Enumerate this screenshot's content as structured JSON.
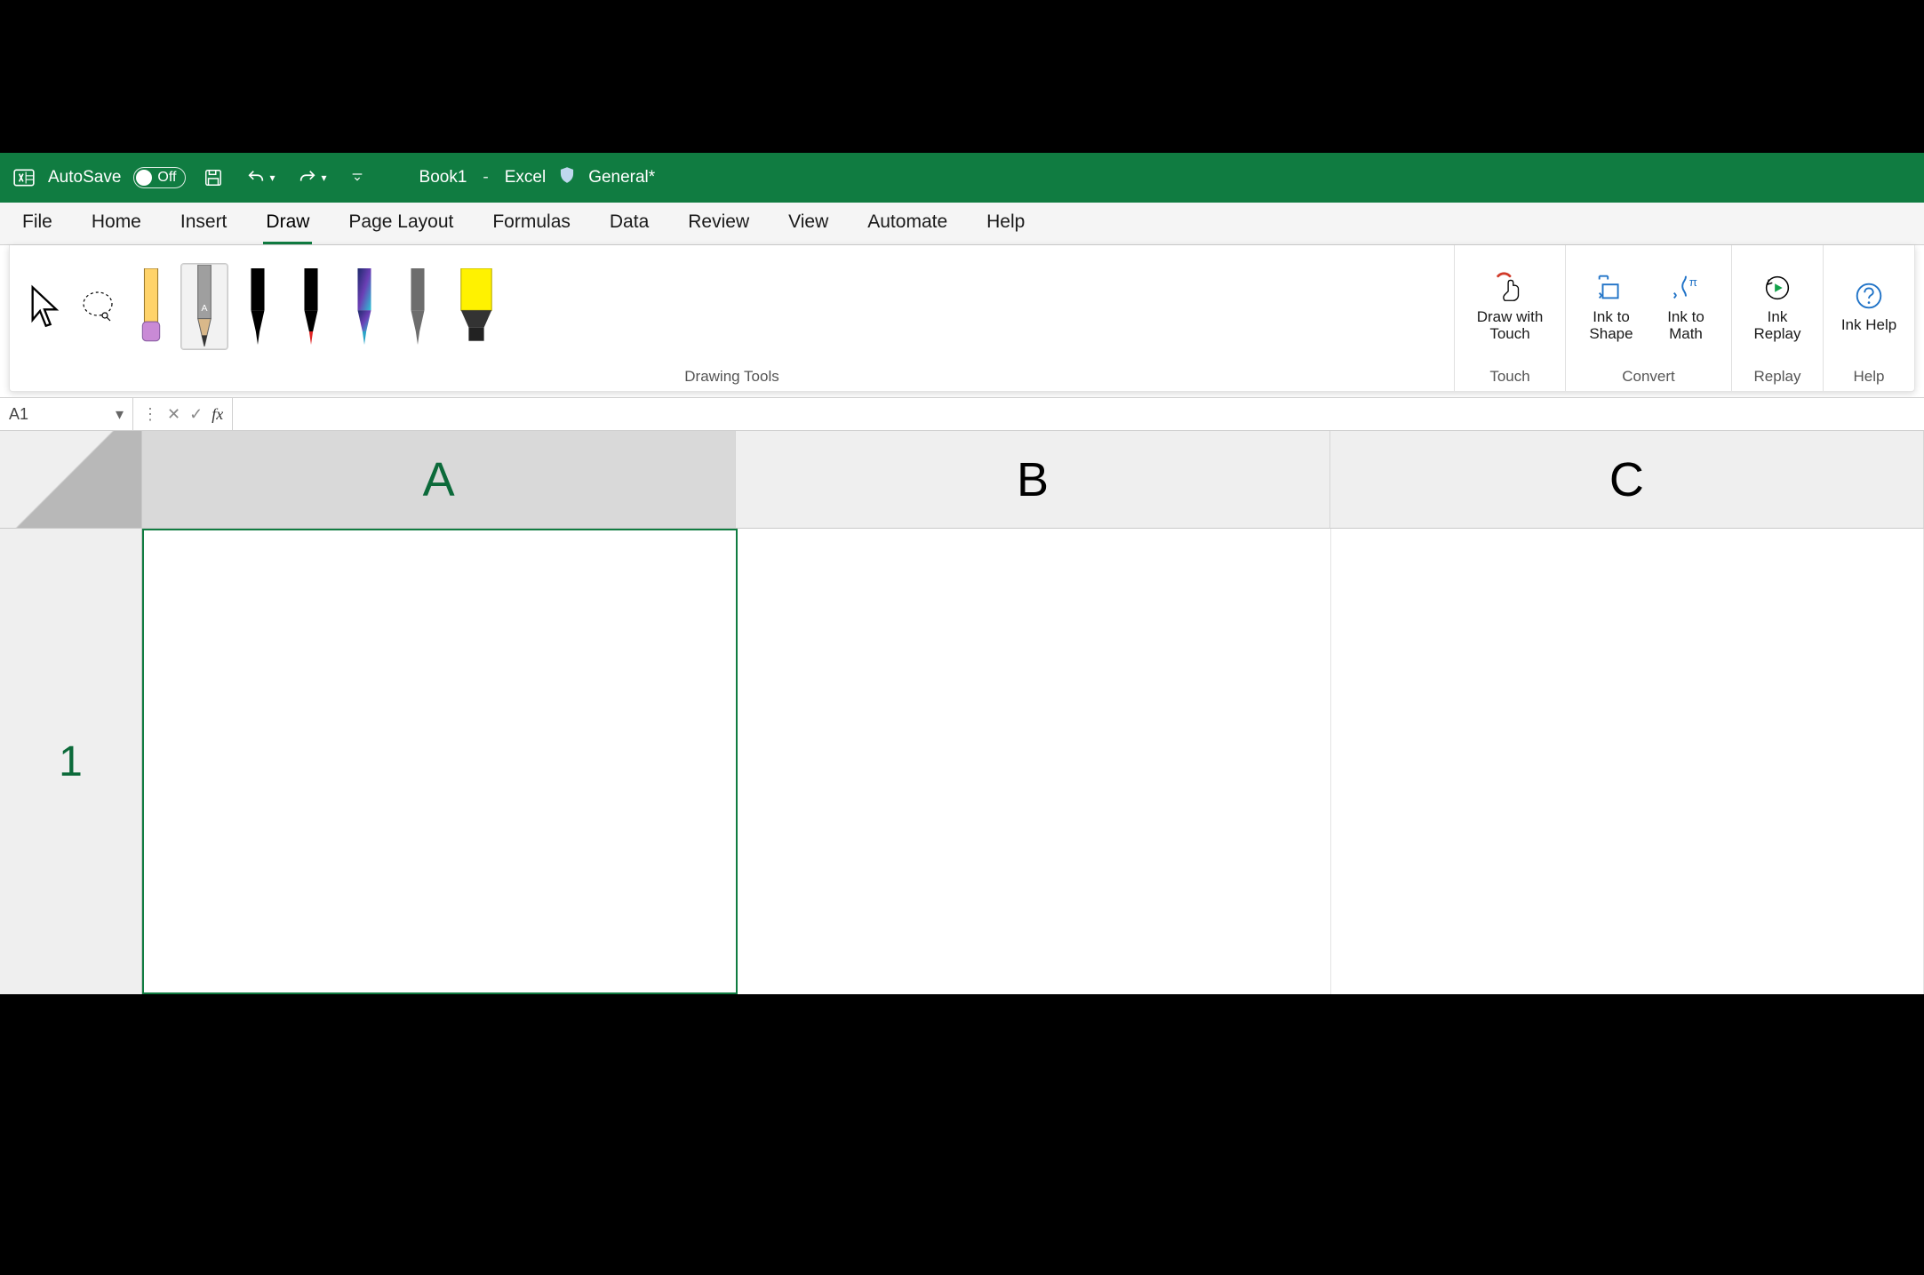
{
  "titlebar": {
    "autosave_label": "AutoSave",
    "autosave_state": "Off",
    "document_name": "Book1",
    "app_name": "Excel",
    "sensitivity": "General*"
  },
  "tabs": [
    {
      "label": "File",
      "active": false
    },
    {
      "label": "Home",
      "active": false
    },
    {
      "label": "Insert",
      "active": false
    },
    {
      "label": "Draw",
      "active": true
    },
    {
      "label": "Page Layout",
      "active": false
    },
    {
      "label": "Formulas",
      "active": false
    },
    {
      "label": "Data",
      "active": false
    },
    {
      "label": "Review",
      "active": false
    },
    {
      "label": "View",
      "active": false
    },
    {
      "label": "Automate",
      "active": false
    },
    {
      "label": "Help",
      "active": false
    }
  ],
  "ribbon": {
    "groups": {
      "drawing_tools": {
        "label": "Drawing Tools"
      },
      "touch": {
        "label": "Touch",
        "draw_with_touch": "Draw with Touch"
      },
      "convert": {
        "label": "Convert",
        "ink_to_shape": "Ink to Shape",
        "ink_to_math": "Ink to Math"
      },
      "replay": {
        "label": "Replay",
        "ink_replay": "Ink Replay"
      },
      "help": {
        "label": "Help",
        "ink_help": "Ink Help"
      }
    },
    "pens": [
      {
        "name": "eraser",
        "body": "#FFD36A",
        "tip": "#C98AD6",
        "shape": "eraser"
      },
      {
        "name": "pencil",
        "body": "#9F9F9F",
        "tip": "#333",
        "shape": "pencil",
        "selected": true
      },
      {
        "name": "pen-black",
        "body": "#000",
        "tip": "#000",
        "shape": "pen"
      },
      {
        "name": "pen-red",
        "body": "#000",
        "tip": "#E02424",
        "shape": "pen"
      },
      {
        "name": "pen-galaxy",
        "body": "#2E2E6E",
        "tip": "#2AA4C7",
        "shape": "pen"
      },
      {
        "name": "pen-gray",
        "body": "#6D6D6D",
        "tip": "#6D6D6D",
        "shape": "pen"
      },
      {
        "name": "highlighter",
        "body": "#FFF200",
        "tip": "#000",
        "shape": "highlighter"
      }
    ]
  },
  "formula_bar": {
    "name_box": "A1",
    "fx_label": "fx",
    "value": ""
  },
  "grid": {
    "columns": [
      "A",
      "B",
      "C"
    ],
    "rows": [
      "1"
    ],
    "active_cell": "A1"
  },
  "colors": {
    "brand": "#107C41",
    "accent_blue": "#2073C7"
  }
}
